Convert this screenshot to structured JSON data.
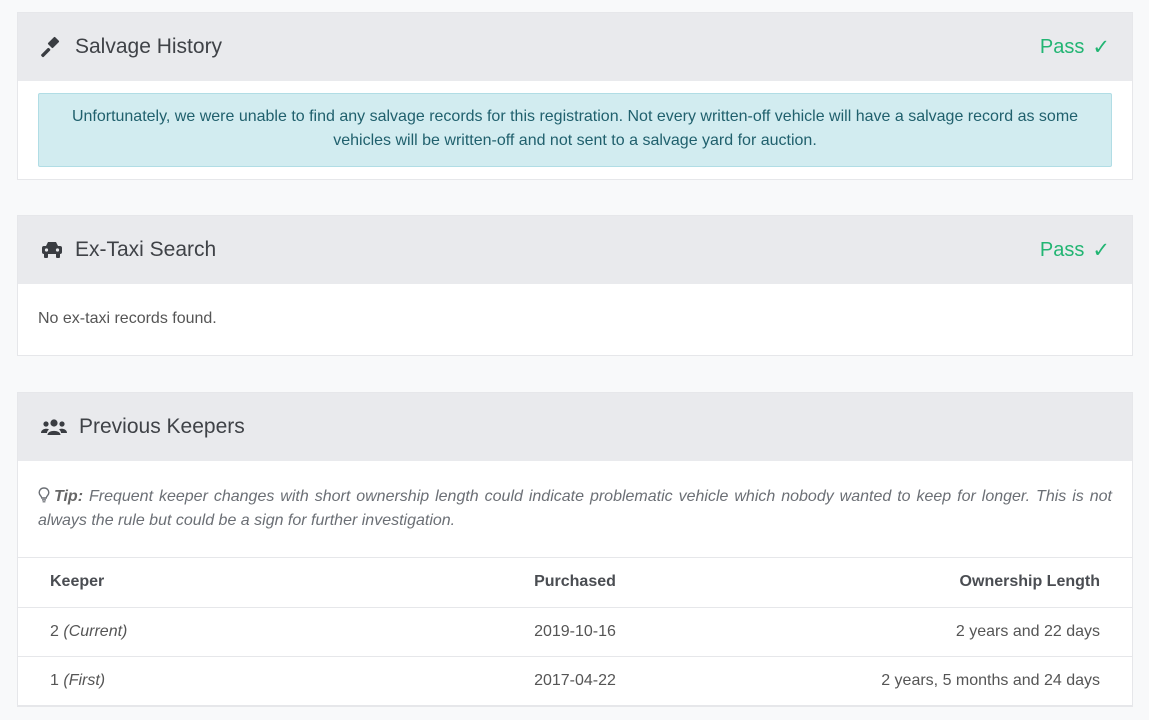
{
  "salvage": {
    "icon": "gavel-icon",
    "title": "Salvage History",
    "status": "Pass",
    "message": "Unfortunately, we were unable to find any salvage records for this registration. Not every written-off vehicle will have a salvage record as some vehicles will be written-off and not sent to a salvage yard for auction."
  },
  "taxi": {
    "icon": "taxi-icon",
    "title": "Ex-Taxi Search",
    "status": "Pass",
    "message": "No ex-taxi records found."
  },
  "keepers": {
    "icon": "users-icon",
    "title": "Previous Keepers",
    "tip_label": "Tip:",
    "tip_text": "Frequent keeper changes with short ownership length could indicate problematic vehicle which nobody wanted to keep for longer. This is not always the rule but could be a sign for further investigation.",
    "columns": [
      "Keeper",
      "Purchased",
      "Ownership Length"
    ],
    "rows": [
      {
        "keeper": "2",
        "note": "(Current)",
        "purchased": "2019-10-16",
        "length": "2 years and 22 days"
      },
      {
        "keeper": "1",
        "note": "(First)",
        "purchased": "2017-04-22",
        "length": "2 years, 5 months and 24 days"
      }
    ]
  },
  "colors": {
    "pass": "#22b573",
    "header_bg": "#e9eaed",
    "alert_bg": "#d2ecf0"
  }
}
